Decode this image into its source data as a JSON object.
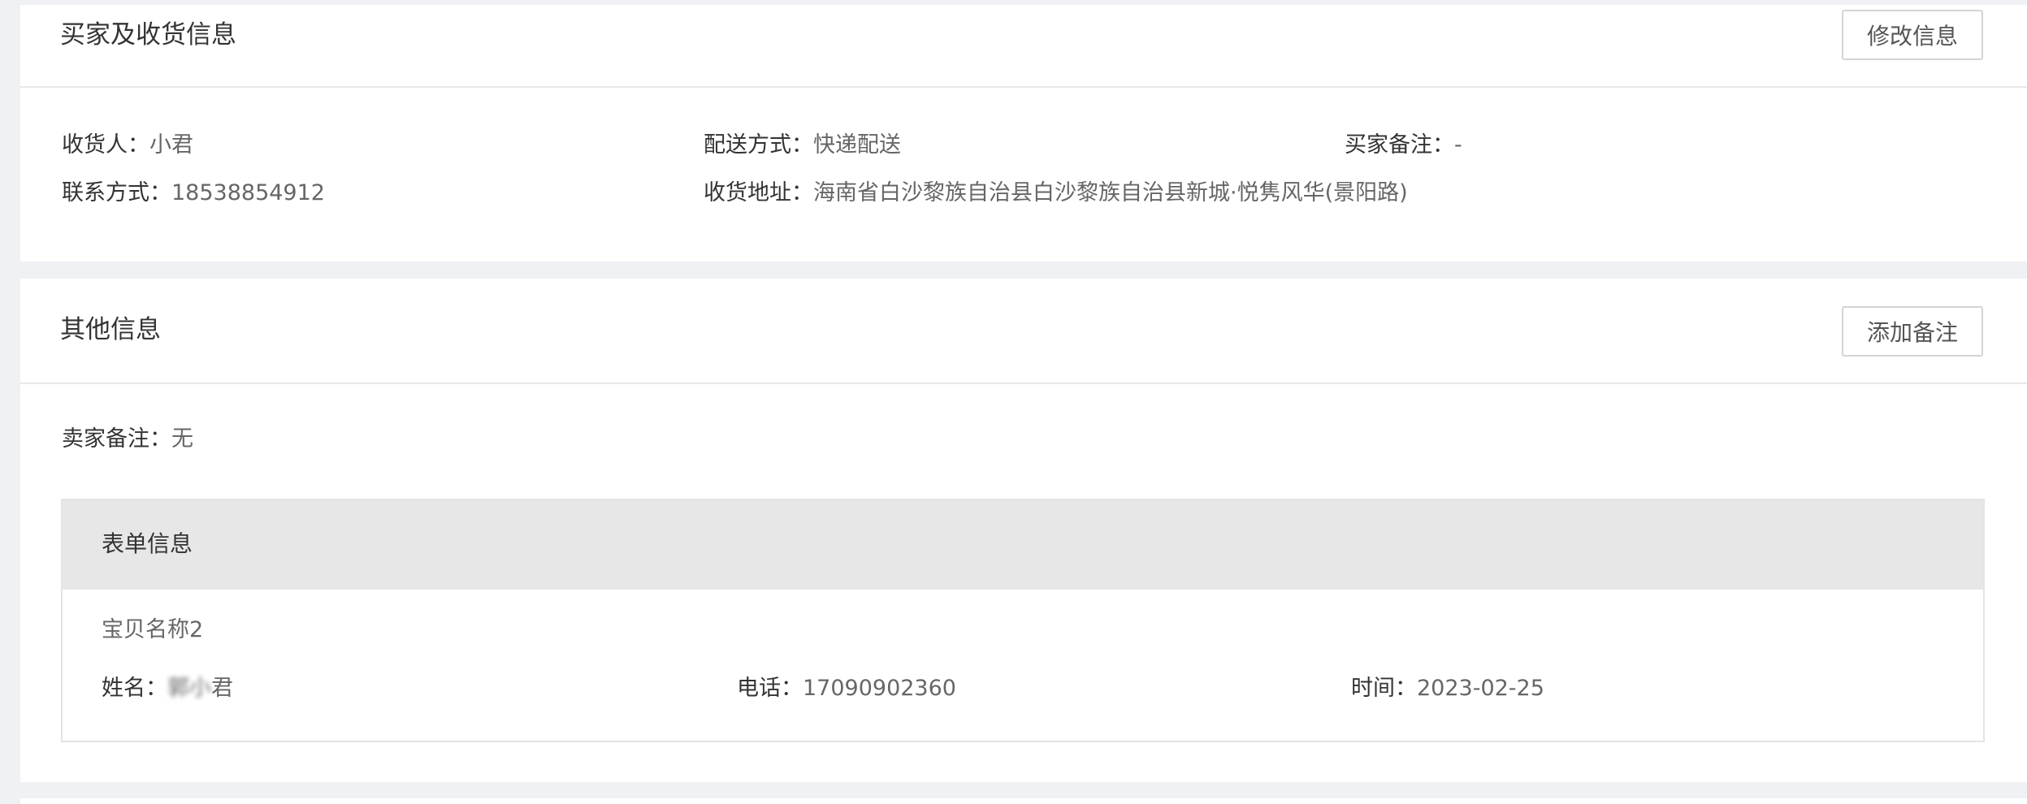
{
  "buyer_section": {
    "title": "买家及收货信息",
    "edit_button": "修改信息",
    "fields": {
      "receiver_label": "收货人：",
      "receiver_value": "小君",
      "contact_label": "联系方式：",
      "contact_value": "18538854912",
      "delivery_label": "配送方式：",
      "delivery_value": "快递配送",
      "address_label": "收货地址：",
      "address_value": "海南省白沙黎族自治县白沙黎族自治县新城·悦隽风华(景阳路)",
      "buyer_note_label": "买家备注：",
      "buyer_note_value": "-"
    }
  },
  "other_section": {
    "title": "其他信息",
    "add_note_button": "添加备注",
    "seller_note_label": "卖家备注：",
    "seller_note_value": "无",
    "form": {
      "title": "表单信息",
      "item_name": "宝贝名称2",
      "name_label": "姓名：",
      "name_value_blurred": "郭",
      "name_value_visible": "君",
      "phone_label": "电话：",
      "phone_value": "17090902360",
      "time_label": "时间：",
      "time_value": "2023-02-25"
    }
  }
}
